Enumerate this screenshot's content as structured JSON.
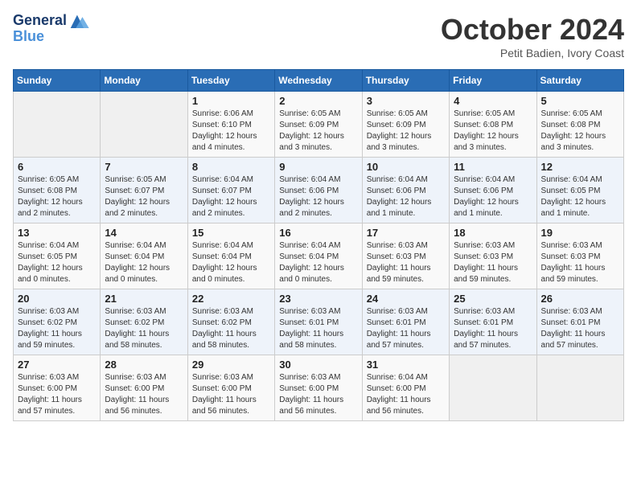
{
  "header": {
    "logo_line1": "General",
    "logo_line2": "Blue",
    "month": "October 2024",
    "location": "Petit Badien, Ivory Coast"
  },
  "days_of_week": [
    "Sunday",
    "Monday",
    "Tuesday",
    "Wednesday",
    "Thursday",
    "Friday",
    "Saturday"
  ],
  "weeks": [
    [
      {
        "day": "",
        "info": ""
      },
      {
        "day": "",
        "info": ""
      },
      {
        "day": "1",
        "info": "Sunrise: 6:06 AM\nSunset: 6:10 PM\nDaylight: 12 hours and 4 minutes."
      },
      {
        "day": "2",
        "info": "Sunrise: 6:05 AM\nSunset: 6:09 PM\nDaylight: 12 hours and 3 minutes."
      },
      {
        "day": "3",
        "info": "Sunrise: 6:05 AM\nSunset: 6:09 PM\nDaylight: 12 hours and 3 minutes."
      },
      {
        "day": "4",
        "info": "Sunrise: 6:05 AM\nSunset: 6:08 PM\nDaylight: 12 hours and 3 minutes."
      },
      {
        "day": "5",
        "info": "Sunrise: 6:05 AM\nSunset: 6:08 PM\nDaylight: 12 hours and 3 minutes."
      }
    ],
    [
      {
        "day": "6",
        "info": "Sunrise: 6:05 AM\nSunset: 6:08 PM\nDaylight: 12 hours and 2 minutes."
      },
      {
        "day": "7",
        "info": "Sunrise: 6:05 AM\nSunset: 6:07 PM\nDaylight: 12 hours and 2 minutes."
      },
      {
        "day": "8",
        "info": "Sunrise: 6:04 AM\nSunset: 6:07 PM\nDaylight: 12 hours and 2 minutes."
      },
      {
        "day": "9",
        "info": "Sunrise: 6:04 AM\nSunset: 6:06 PM\nDaylight: 12 hours and 2 minutes."
      },
      {
        "day": "10",
        "info": "Sunrise: 6:04 AM\nSunset: 6:06 PM\nDaylight: 12 hours and 1 minute."
      },
      {
        "day": "11",
        "info": "Sunrise: 6:04 AM\nSunset: 6:06 PM\nDaylight: 12 hours and 1 minute."
      },
      {
        "day": "12",
        "info": "Sunrise: 6:04 AM\nSunset: 6:05 PM\nDaylight: 12 hours and 1 minute."
      }
    ],
    [
      {
        "day": "13",
        "info": "Sunrise: 6:04 AM\nSunset: 6:05 PM\nDaylight: 12 hours and 0 minutes."
      },
      {
        "day": "14",
        "info": "Sunrise: 6:04 AM\nSunset: 6:04 PM\nDaylight: 12 hours and 0 minutes."
      },
      {
        "day": "15",
        "info": "Sunrise: 6:04 AM\nSunset: 6:04 PM\nDaylight: 12 hours and 0 minutes."
      },
      {
        "day": "16",
        "info": "Sunrise: 6:04 AM\nSunset: 6:04 PM\nDaylight: 12 hours and 0 minutes."
      },
      {
        "day": "17",
        "info": "Sunrise: 6:03 AM\nSunset: 6:03 PM\nDaylight: 11 hours and 59 minutes."
      },
      {
        "day": "18",
        "info": "Sunrise: 6:03 AM\nSunset: 6:03 PM\nDaylight: 11 hours and 59 minutes."
      },
      {
        "day": "19",
        "info": "Sunrise: 6:03 AM\nSunset: 6:03 PM\nDaylight: 11 hours and 59 minutes."
      }
    ],
    [
      {
        "day": "20",
        "info": "Sunrise: 6:03 AM\nSunset: 6:02 PM\nDaylight: 11 hours and 59 minutes."
      },
      {
        "day": "21",
        "info": "Sunrise: 6:03 AM\nSunset: 6:02 PM\nDaylight: 11 hours and 58 minutes."
      },
      {
        "day": "22",
        "info": "Sunrise: 6:03 AM\nSunset: 6:02 PM\nDaylight: 11 hours and 58 minutes."
      },
      {
        "day": "23",
        "info": "Sunrise: 6:03 AM\nSunset: 6:01 PM\nDaylight: 11 hours and 58 minutes."
      },
      {
        "day": "24",
        "info": "Sunrise: 6:03 AM\nSunset: 6:01 PM\nDaylight: 11 hours and 57 minutes."
      },
      {
        "day": "25",
        "info": "Sunrise: 6:03 AM\nSunset: 6:01 PM\nDaylight: 11 hours and 57 minutes."
      },
      {
        "day": "26",
        "info": "Sunrise: 6:03 AM\nSunset: 6:01 PM\nDaylight: 11 hours and 57 minutes."
      }
    ],
    [
      {
        "day": "27",
        "info": "Sunrise: 6:03 AM\nSunset: 6:00 PM\nDaylight: 11 hours and 57 minutes."
      },
      {
        "day": "28",
        "info": "Sunrise: 6:03 AM\nSunset: 6:00 PM\nDaylight: 11 hours and 56 minutes."
      },
      {
        "day": "29",
        "info": "Sunrise: 6:03 AM\nSunset: 6:00 PM\nDaylight: 11 hours and 56 minutes."
      },
      {
        "day": "30",
        "info": "Sunrise: 6:03 AM\nSunset: 6:00 PM\nDaylight: 11 hours and 56 minutes."
      },
      {
        "day": "31",
        "info": "Sunrise: 6:04 AM\nSunset: 6:00 PM\nDaylight: 11 hours and 56 minutes."
      },
      {
        "day": "",
        "info": ""
      },
      {
        "day": "",
        "info": ""
      }
    ]
  ]
}
